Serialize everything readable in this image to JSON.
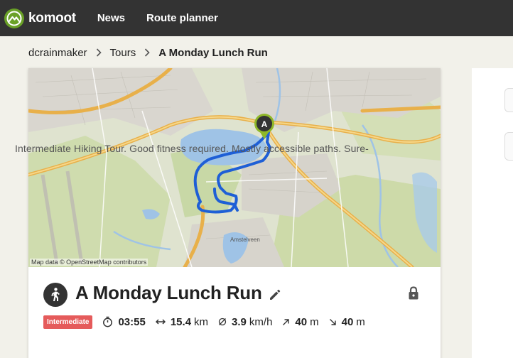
{
  "header": {
    "brand": "komoot",
    "nav": [
      {
        "label": "News"
      },
      {
        "label": "Route planner"
      }
    ]
  },
  "breadcrumb": {
    "items": [
      "dcrainmaker",
      "Tours"
    ],
    "current": "A Monday Lunch Run"
  },
  "map": {
    "attribution": "Map data © OpenStreetMap contributors",
    "start_marker": "A",
    "place_labels": [
      "Amstelveen"
    ],
    "route_color": "#1e5fd6"
  },
  "tour": {
    "title": "A Monday Lunch Run",
    "difficulty": "Intermediate",
    "duration": "03:55",
    "distance_value": "15.4",
    "distance_unit": "km",
    "speed_value": "3.9",
    "speed_unit": "km/h",
    "uphill_value": "40",
    "uphill_unit": "m",
    "downhill_value": "40",
    "downhill_unit": "m",
    "description": "Intermediate Hiking Tour. Good fitness required. Mostly accessible paths. Sure-",
    "sport_icon": "hiking-icon"
  },
  "colors": {
    "topbar": "#333333",
    "brand_green": "#6aa127",
    "difficulty_badge": "#e55b5b",
    "page_bg": "#f2f1ea"
  }
}
